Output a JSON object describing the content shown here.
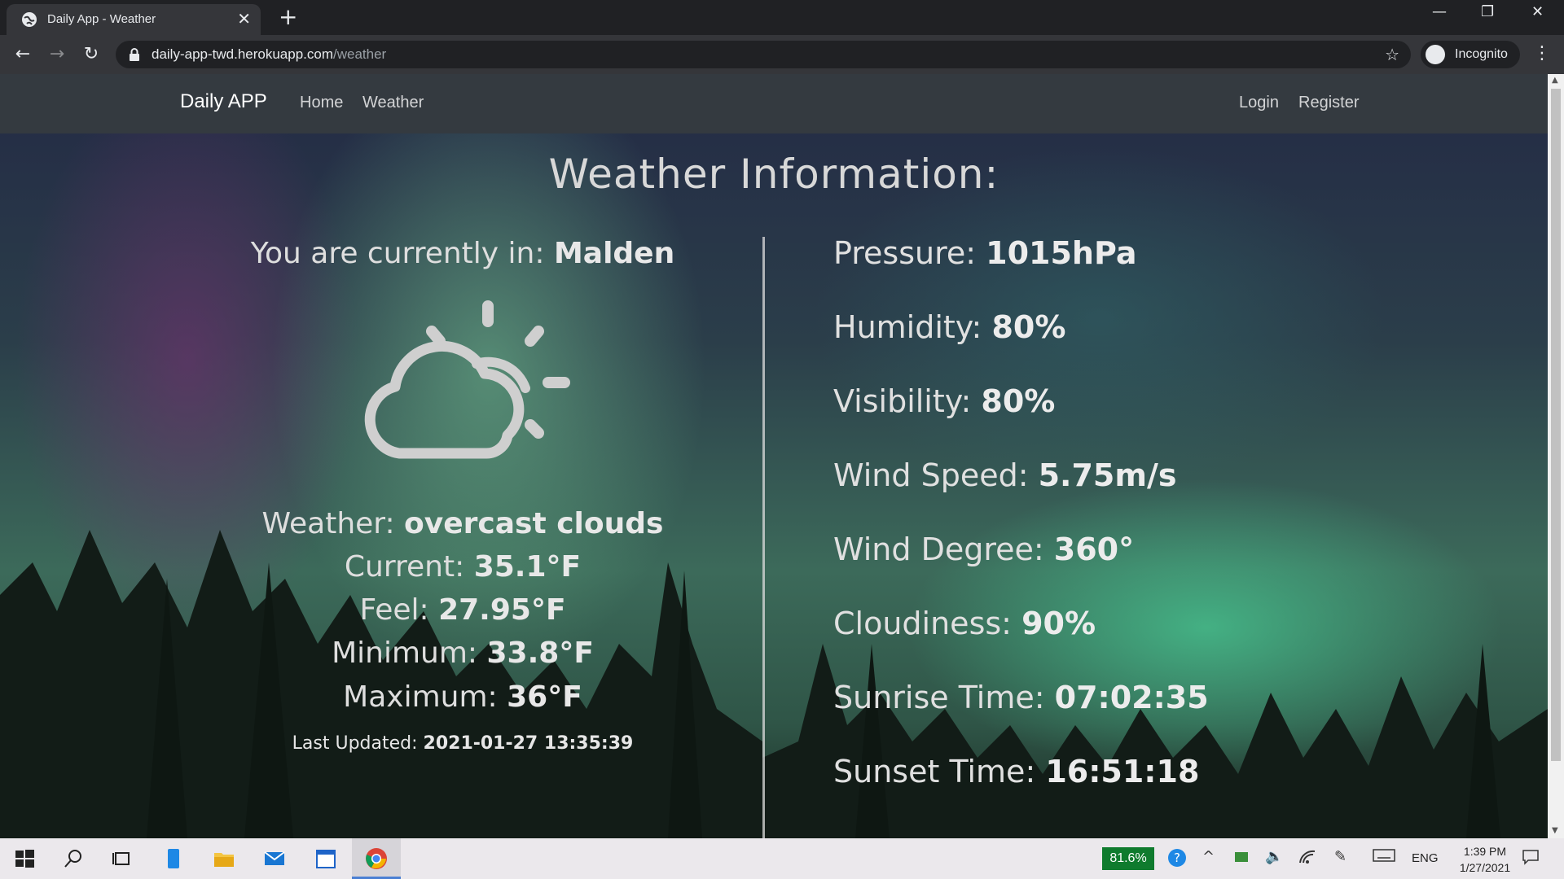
{
  "browser": {
    "tab_title": "Daily App - Weather",
    "url_domain": "daily-app-twd.herokuapp.com",
    "url_path": "/weather",
    "profile_label": "Incognito"
  },
  "navbar": {
    "brand": "Daily APP",
    "links": [
      "Home",
      "Weather"
    ],
    "login": "Login",
    "register": "Register"
  },
  "page": {
    "heading": "Weather Information:",
    "location_label": "You are currently in:",
    "location": "Malden",
    "weather_icon": "partly-cloudy-icon",
    "left_stats": [
      {
        "label": "Weather:",
        "value": "overcast clouds"
      },
      {
        "label": "Current:",
        "value": "35.1°F"
      },
      {
        "label": "Feel:",
        "value": "27.95°F"
      },
      {
        "label": "Minimum:",
        "value": "33.8°F"
      },
      {
        "label": "Maximum:",
        "value": "36°F"
      }
    ],
    "right_stats": [
      {
        "label": "Pressure:",
        "value": "1015hPa"
      },
      {
        "label": "Humidity:",
        "value": "80%"
      },
      {
        "label": "Visibility:",
        "value": "80%"
      },
      {
        "label": "Wind Speed:",
        "value": "5.75m/s"
      },
      {
        "label": "Wind Degree:",
        "value": "360°"
      },
      {
        "label": "Cloudiness:",
        "value": "90%"
      },
      {
        "label": "Sunrise Time:",
        "value": "07:02:35"
      },
      {
        "label": "Sunset Time:",
        "value": "16:51:18"
      }
    ],
    "updated_label": "Last Updated:",
    "updated_value": "2021-01-27 13:35:39"
  },
  "taskbar": {
    "battery": "81.6%",
    "language": "ENG",
    "time": "1:39 PM",
    "date": "1/27/2021"
  }
}
